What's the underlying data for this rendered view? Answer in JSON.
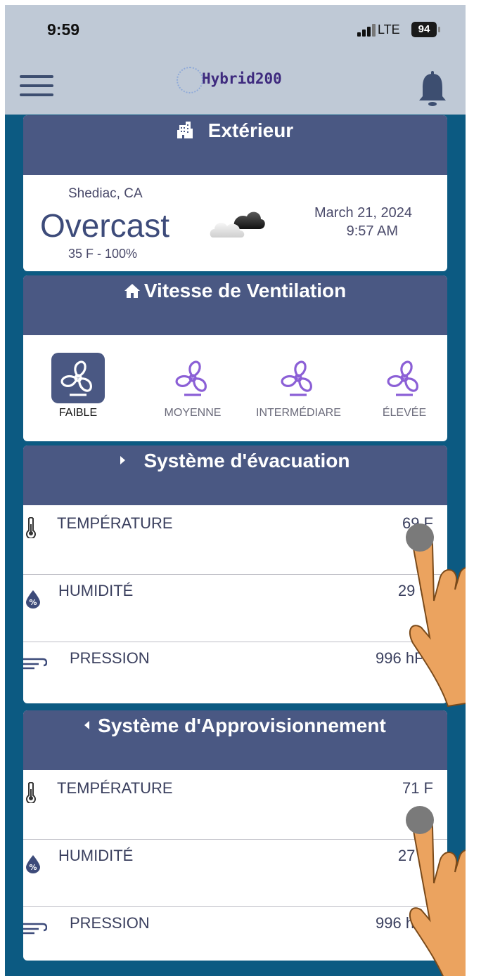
{
  "status_bar": {
    "time": "9:59",
    "network": "LTE",
    "battery": "94"
  },
  "app_bar": {
    "logo_text": "Hybrid200"
  },
  "exterior": {
    "title": "Extérieur",
    "location": "Shediac, CA",
    "condition": "Overcast",
    "temp_humidity": "35 F - 100%",
    "date": "March 21, 2024",
    "time": "9:57 AM"
  },
  "ventilation": {
    "title": "Vitesse de Ventilation",
    "speeds": [
      {
        "label": "FAIBLE",
        "active": true
      },
      {
        "label": "MOYENNE",
        "active": false
      },
      {
        "label": "INTERMÉDIARE",
        "active": false
      },
      {
        "label": "ÉLEVÉE",
        "active": false
      }
    ]
  },
  "exhaust": {
    "title": "Système d'évacuation",
    "rows": [
      {
        "name": "TEMPÉRATURE",
        "value": "69 F",
        "icon": "thermometer-icon"
      },
      {
        "name": "HUMIDITÉ",
        "value": "29 %",
        "icon": "humidity-icon"
      },
      {
        "name": "PRESSION",
        "value": "996 hPa",
        "icon": "wind-icon"
      }
    ]
  },
  "supply": {
    "title": "Système d'Approvisionnement",
    "rows": [
      {
        "name": "TEMPÉRATURE",
        "value": "71 F",
        "icon": "thermometer-icon"
      },
      {
        "name": "HUMIDITÉ",
        "value": "27 %",
        "icon": "humidity-icon"
      },
      {
        "name": "PRESSION",
        "value": "996 hPa",
        "icon": "wind-icon"
      }
    ]
  },
  "colors": {
    "header": "#4a5883",
    "background": "#0c5a82",
    "appbar": "#bfc9d6",
    "fan_inactive": "#8b5fd6",
    "hand": "#eba35f"
  }
}
